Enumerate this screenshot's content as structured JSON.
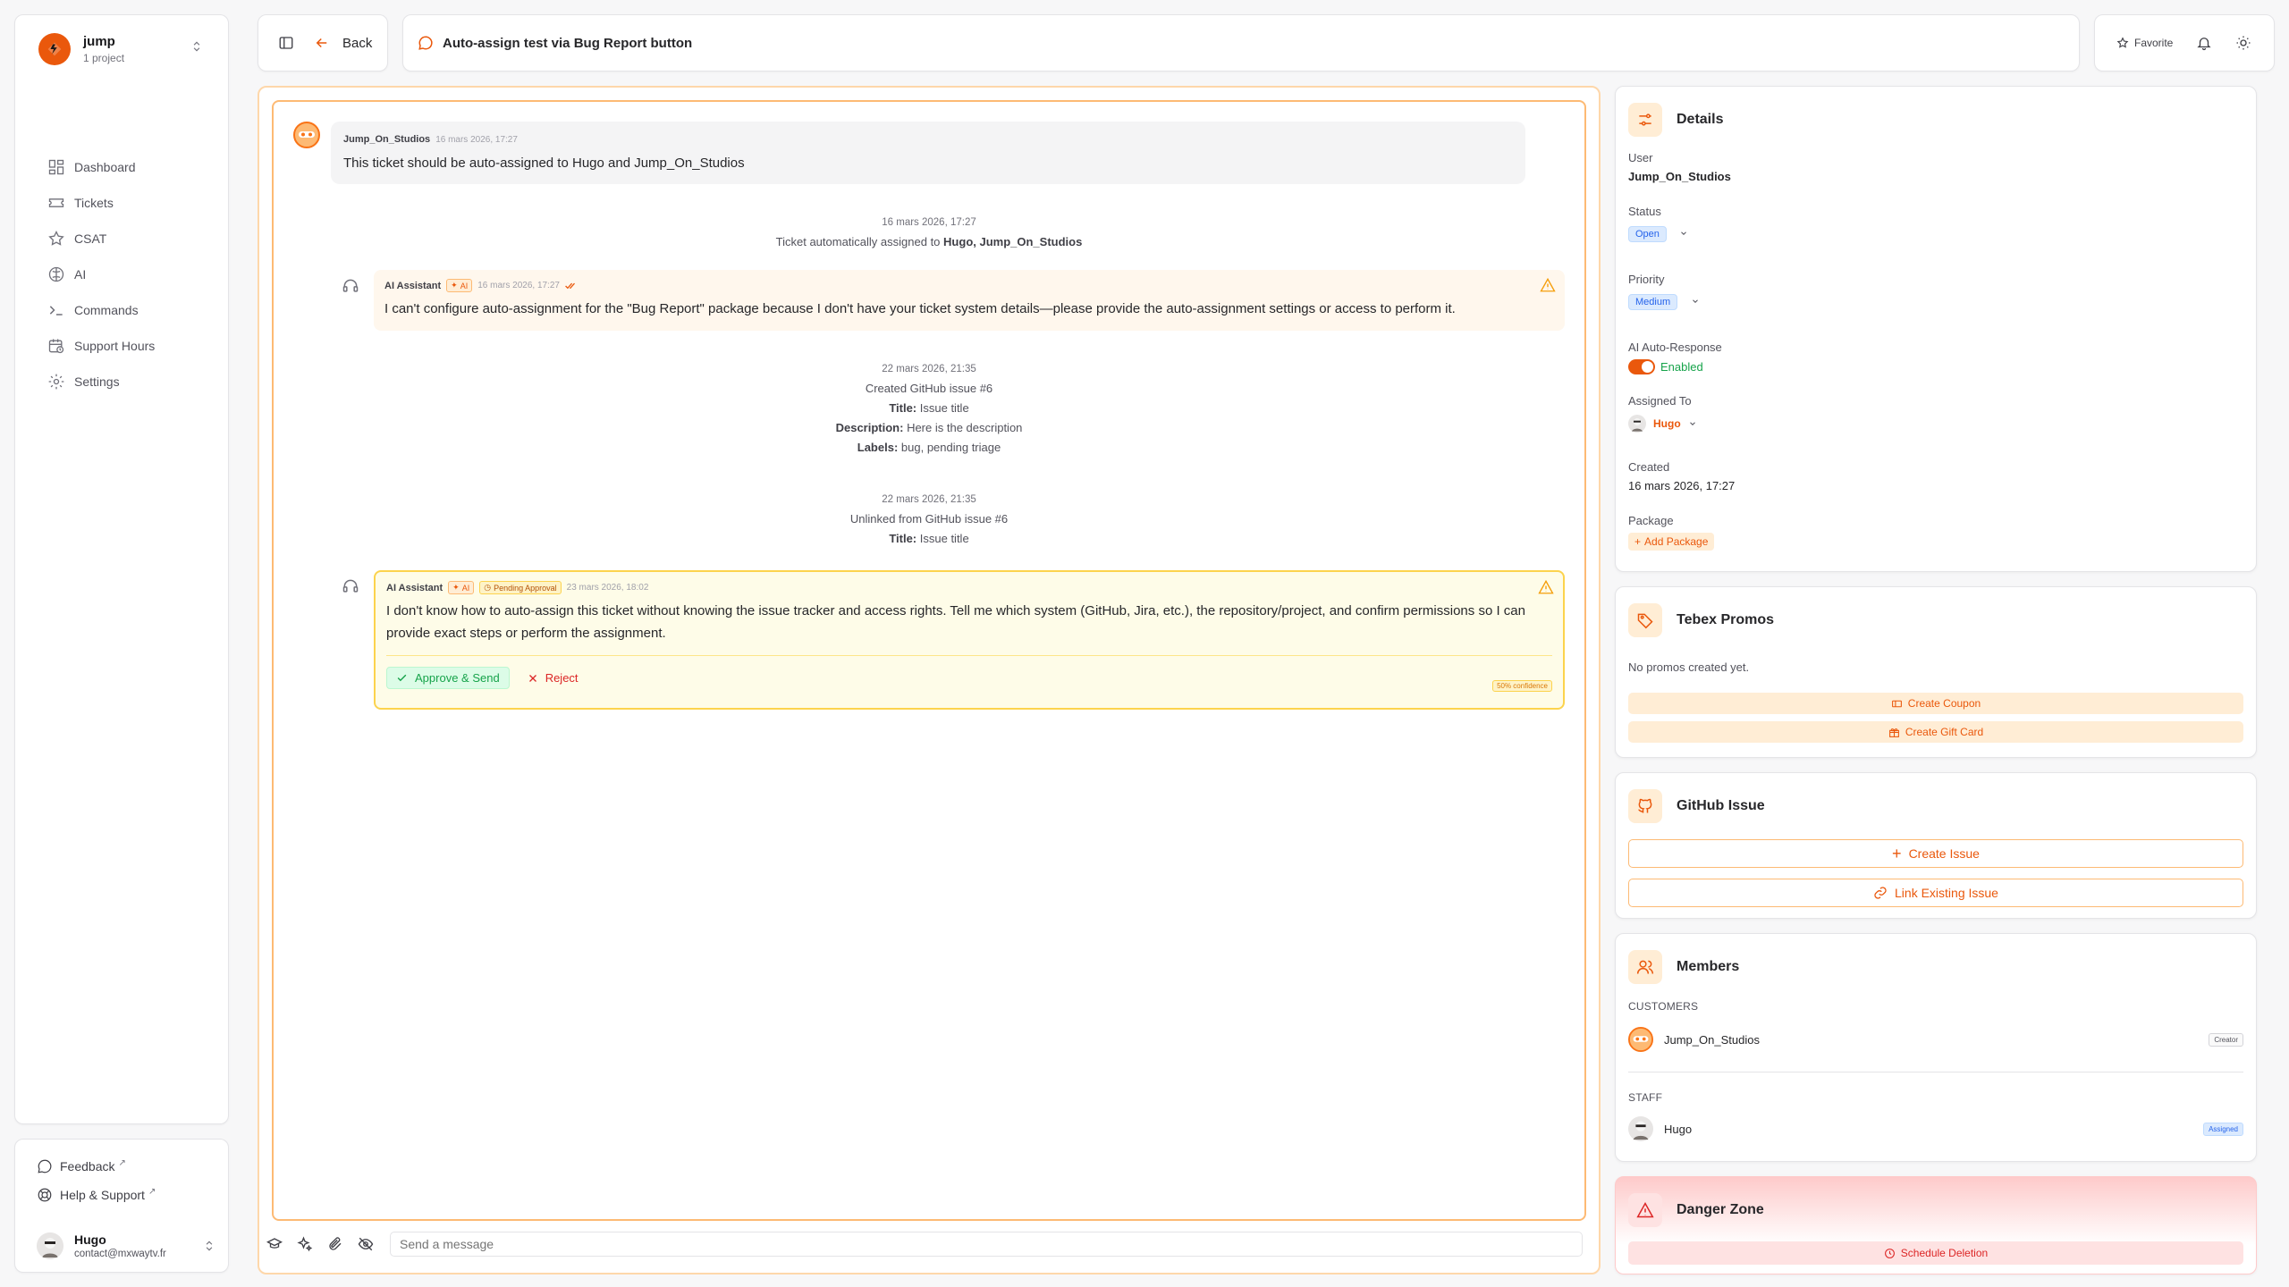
{
  "sidebar": {
    "workspace": {
      "name": "jump",
      "sub": "1 project"
    },
    "nav": [
      {
        "label": "Dashboard",
        "icon": "dashboard-icon"
      },
      {
        "label": "Tickets",
        "icon": "ticket-icon"
      },
      {
        "label": "CSAT",
        "icon": "star-icon"
      },
      {
        "label": "AI",
        "icon": "ai-icon"
      },
      {
        "label": "Commands",
        "icon": "terminal-icon"
      },
      {
        "label": "Support Hours",
        "icon": "calendar-clock-icon"
      },
      {
        "label": "Settings",
        "icon": "gear-icon"
      }
    ],
    "footer": {
      "feedback": "Feedback",
      "help": "Help & Support"
    },
    "user": {
      "name": "Hugo",
      "email": "contact@mxwaytv.fr"
    }
  },
  "header": {
    "back_label": "Back",
    "ticket_title": "Auto-assign test via Bug Report button",
    "favorite_label": "Favorite"
  },
  "chat": {
    "user_msg": {
      "author": "Jump_On_Studios",
      "time": "16 mars 2026, 17:27",
      "text": "This ticket should be auto-assigned to Hugo and Jump_On_Studios"
    },
    "sys1": {
      "date": "16 mars 2026, 17:27",
      "prefix": "Ticket automatically assigned to",
      "names": "Hugo, Jump_On_Studios"
    },
    "ai1": {
      "author": "AI Assistant",
      "badge": "AI",
      "time": "16 mars 2026, 17:27",
      "text": "I can't configure auto-assignment for the \"Bug Report\" package because I don't have your ticket system details—please provide the auto-assignment settings or access to perform it."
    },
    "sys2": {
      "date": "22 mars 2026, 21:35",
      "line1": "Created GitHub issue #6",
      "title_k": "Title:",
      "title_v": "Issue title",
      "desc_k": "Description:",
      "desc_v": "Here is the description",
      "labels_k": "Labels:",
      "labels_v": "bug, pending triage"
    },
    "sys3": {
      "date": "22 mars 2026, 21:35",
      "line1": "Unlinked from GitHub issue #6",
      "title_k": "Title:",
      "title_v": "Issue title"
    },
    "ai2": {
      "author": "AI Assistant",
      "badge": "AI",
      "pending": "Pending Approval",
      "time": "23 mars 2026, 18:02",
      "text": "I don't know how to auto-assign this ticket without knowing the issue tracker and access rights. Tell me which system (GitHub, Jira, etc.), the repository/project, and confirm permissions so I can provide exact steps or perform the assignment.",
      "approve": "Approve & Send",
      "reject": "Reject",
      "confidence": "50% confidence"
    },
    "composer_placeholder": "Send a message"
  },
  "details": {
    "title": "Details",
    "user_label": "User",
    "user_value": "Jump_On_Studios",
    "status_label": "Status",
    "status_value": "Open",
    "priority_label": "Priority",
    "priority_value": "Medium",
    "ai_label": "AI Auto-Response",
    "ai_value": "Enabled",
    "assigned_label": "Assigned To",
    "assigned_value": "Hugo",
    "created_label": "Created",
    "created_value": "16 mars 2026, 17:27",
    "package_label": "Package",
    "package_action": "Add Package"
  },
  "promos": {
    "title": "Tebex Promos",
    "empty": "No promos created yet.",
    "coupon": "Create Coupon",
    "gift": "Create Gift Card"
  },
  "github": {
    "title": "GitHub Issue",
    "create": "Create Issue",
    "link": "Link Existing Issue"
  },
  "members": {
    "title": "Members",
    "customers_label": "CUSTOMERS",
    "customer_name": "Jump_On_Studios",
    "customer_role": "Creator",
    "staff_label": "STAFF",
    "staff_name": "Hugo",
    "staff_role": "Assigned"
  },
  "danger": {
    "title": "Danger Zone",
    "action": "Schedule Deletion"
  },
  "colors": {
    "accent": "#ea580c",
    "success": "#16a34a",
    "danger": "#dc2626",
    "info": "#2563eb"
  }
}
